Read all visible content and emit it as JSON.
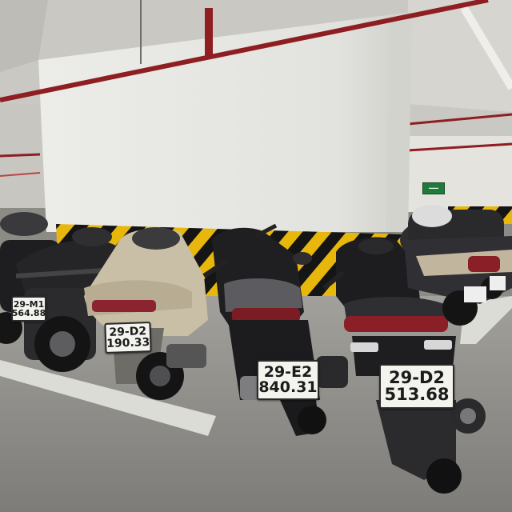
{
  "scene": {
    "description_free": true
  },
  "plates": [
    {
      "id": "plate-left-edge",
      "line1": "29-M1",
      "line2": "564.88"
    },
    {
      "id": "plate-beige-scooter",
      "line1": "29-D2",
      "line2": "190.33"
    },
    {
      "id": "plate-center-scooter",
      "line1": "29-E2",
      "line2": "840.31"
    },
    {
      "id": "plate-right-scooter",
      "line1": "29-D2",
      "line2": "513.68"
    },
    {
      "id": "plate-far-right",
      "line1": "",
      "line2": ""
    }
  ],
  "colors": {
    "ceiling": "#c9c8c2",
    "pillar": "#e6e6e2",
    "pipe": "#8e1e22",
    "hazard_yellow": "#e8b70c",
    "hazard_black": "#151515",
    "floor": "#8d8b86",
    "parking_line": "#dcdcd6"
  }
}
